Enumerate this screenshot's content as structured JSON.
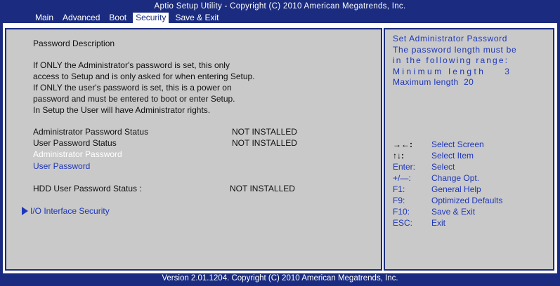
{
  "title": "Aptio Setup Utility - Copyright (C) 2010 American Megatrends, Inc.",
  "menu": [
    {
      "label": "Main",
      "active": false
    },
    {
      "label": "Advanced",
      "active": false
    },
    {
      "label": "Boot",
      "active": false
    },
    {
      "label": "Security",
      "active": true
    },
    {
      "label": "Save & Exit",
      "active": false
    }
  ],
  "description": {
    "heading": "Password Description",
    "lines": [
      "If ONLY the Administrator's password is set, this only",
      "access to Setup and is only asked for when entering Setup.",
      "If ONLY the user's password is set, this is a power on",
      "password and must be entered to boot or enter Setup.",
      "In Setup the User will have Administrator rights."
    ]
  },
  "status": {
    "admin_label": "Administrator Password Status",
    "admin_value": "NOT INSTALLED",
    "user_label": "User Password Status",
    "user_value": "NOT INSTALLED"
  },
  "options": {
    "admin_password": "Administrator Password",
    "user_password": "User Password"
  },
  "hdd": {
    "label": "HDD User Password Status  :",
    "value": "NOT INSTALLED"
  },
  "io_security": "I/O Interface Security",
  "help_text": [
    "Set Administrator Password",
    "The password length must be",
    "in the following range:",
    "Minimum length    3",
    "Maximum length  20"
  ],
  "keys": [
    {
      "key": "→←:",
      "action": "Select Screen"
    },
    {
      "key": "↑↓:",
      "action": "Select Item"
    },
    {
      "key": "Enter:",
      "action": "Select"
    },
    {
      "key": "+/—:",
      "action": "Change Opt."
    },
    {
      "key": "F1:",
      "action": "General Help"
    },
    {
      "key": "F9:",
      "action": "Optimized Defaults"
    },
    {
      "key": "F10:",
      "action": "Save & Exit"
    },
    {
      "key": "ESC:",
      "action": "Exit"
    }
  ],
  "footer": "Version 2.01.1204. Copyright (C) 2010 American Megatrends, Inc.",
  "colors": {
    "background_blue": "#1b2c80",
    "panel_gray": "#c9c9c9",
    "link_blue": "#1f37b8"
  }
}
